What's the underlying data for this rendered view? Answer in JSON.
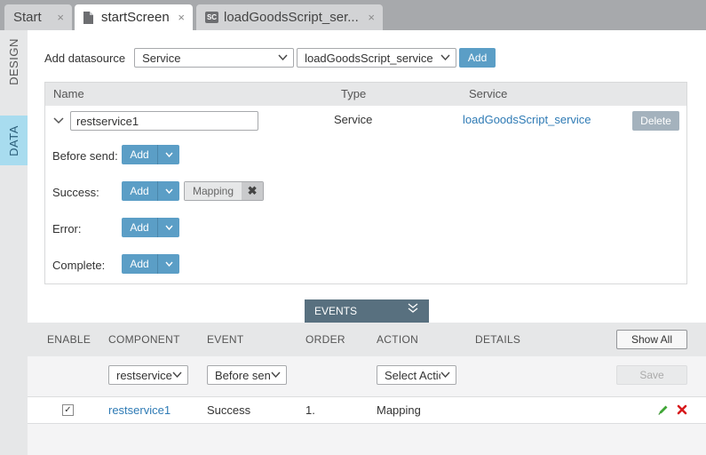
{
  "tabs": [
    {
      "label": "Start",
      "close": "×"
    },
    {
      "label": "startScreen",
      "close": "×"
    },
    {
      "label": "loadGoodsScript_ser...",
      "badge": "SC",
      "close": "×"
    }
  ],
  "side_tabs": {
    "design": "DESIGN",
    "data": "DATA"
  },
  "datasource": {
    "label": "Add datasource",
    "type_value": "Service",
    "service_value": "loadGoodsScript_service",
    "add_label": "Add"
  },
  "table": {
    "headers": {
      "name": "Name",
      "type": "Type",
      "service": "Service"
    },
    "row": {
      "name_value": "restservice1",
      "type": "Service",
      "service": "loadGoodsScript_service",
      "delete_label": "Delete"
    },
    "events": [
      {
        "label": "Before send:",
        "button": "Add"
      },
      {
        "label": "Success:",
        "button": "Add",
        "chip": "Mapping",
        "chip_close": "✖"
      },
      {
        "label": "Error:",
        "button": "Add"
      },
      {
        "label": "Complete:",
        "button": "Add"
      }
    ]
  },
  "events_panel": {
    "toggle_label": "EVENTS",
    "headers": {
      "enable": "ENABLE",
      "component": "COMPONENT",
      "event": "EVENT",
      "order": "ORDER",
      "action": "ACTION",
      "details": "DETAILS"
    },
    "show_all_label": "Show All",
    "filter": {
      "component": "restservice",
      "event": "Before sen",
      "action": "Select Actic",
      "save_label": "Save"
    },
    "rows": [
      {
        "enabled": true,
        "check": "✓",
        "component": "restservice1",
        "event": "Success",
        "order": "1.",
        "action": "Mapping"
      }
    ]
  },
  "colors": {
    "accent": "#5b9ec6",
    "data_tab": "#a8dcef",
    "events_toggle": "#58707f",
    "link": "#2f7bb5"
  }
}
